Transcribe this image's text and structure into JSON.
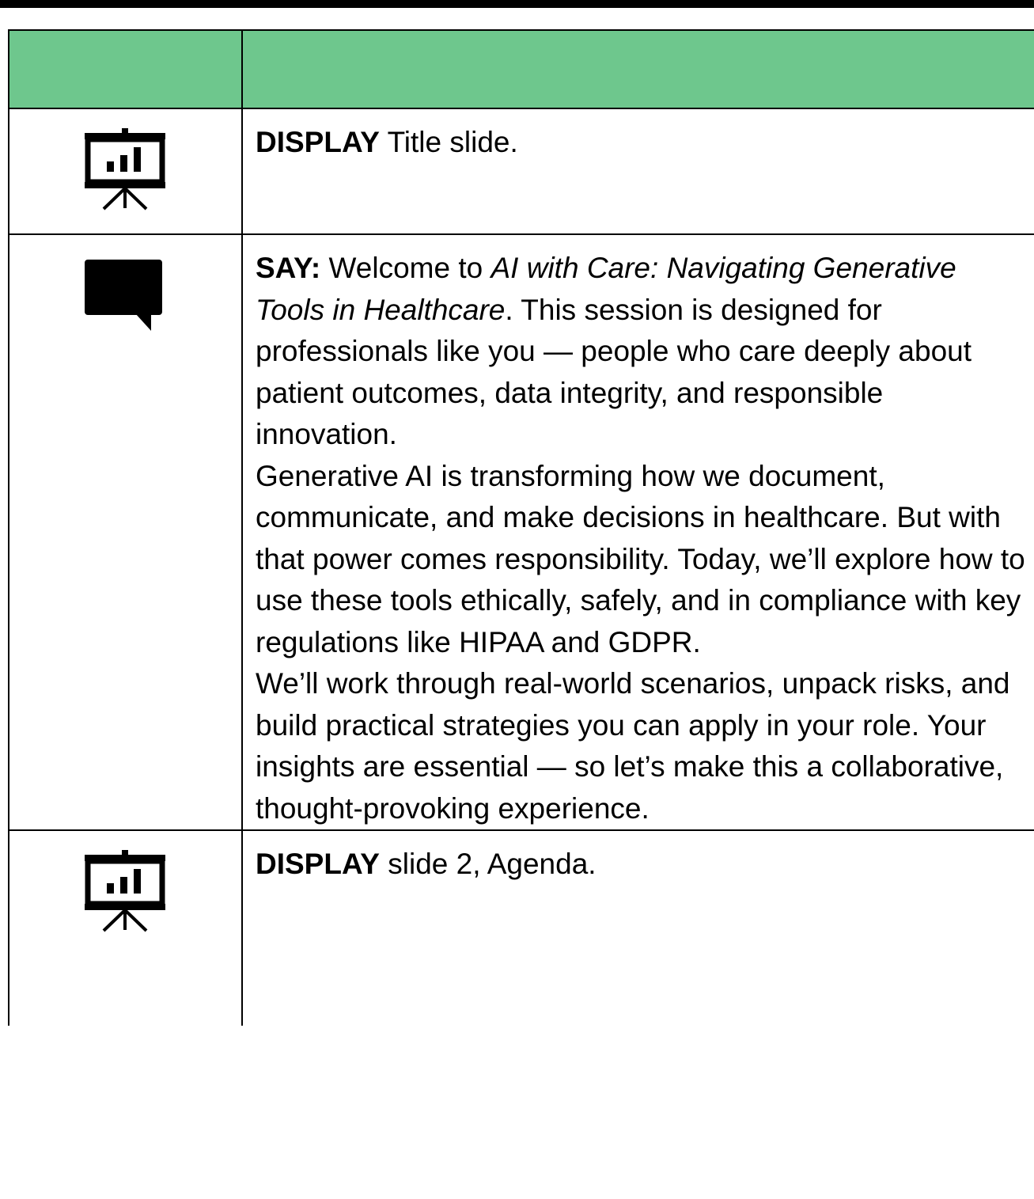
{
  "table": {
    "header": {
      "col1": "",
      "col2": ""
    },
    "rows": [
      {
        "icon": "presentation-icon",
        "label": "DISPLAY",
        "text": " Title slide."
      },
      {
        "icon": "speech-bubble-icon",
        "label": "SAY:",
        "intro": " Welcome to ",
        "course_title": "AI with Care: Navigating Generative Tools in Healthcare",
        "after_title": ". This session is designed for professionals like you — people who care deeply about patient outcomes, data integrity, and responsible innovation.",
        "paragraph2": "Generative AI is transforming how we document, communicate, and make decisions in healthcare. But with that power comes responsibility. Today, we’ll explore how to use these tools ethically, safely, and in compliance with key regulations like HIPAA and GDPR.",
        "paragraph3": "We’ll work through real-world scenarios, unpack risks, and build practical strategies you can apply in your role. Your insights are essential — so let’s make this a collaborative, thought-provoking experience."
      },
      {
        "icon": "presentation-icon",
        "label": "DISPLAY",
        "text": " slide 2, Agenda."
      }
    ]
  },
  "colors": {
    "header_bg": "#6ec78d",
    "rule": "#000000"
  }
}
